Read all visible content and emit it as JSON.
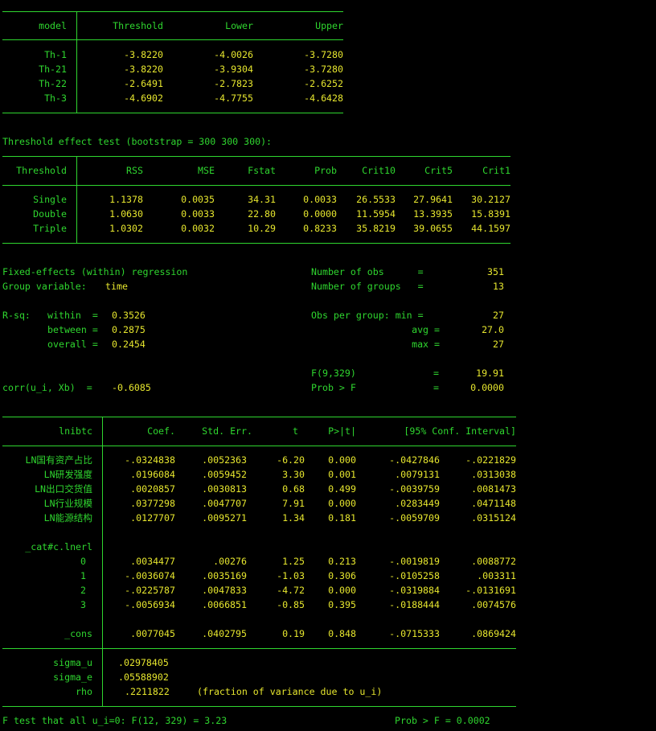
{
  "colors": {
    "background": "#000000",
    "text_green": "#2fd62f",
    "value_yellow": "#e6e62e"
  },
  "table1": {
    "headers": [
      "model",
      "Threshold",
      "Lower",
      "Upper"
    ],
    "rows": [
      [
        "Th-1",
        "-3.8220",
        "-4.0026",
        "-3.7280"
      ],
      [
        "Th-21",
        "-3.8220",
        "-3.9304",
        "-3.7280"
      ],
      [
        "Th-22",
        "-2.6491",
        "-2.7823",
        "-2.6252"
      ],
      [
        "Th-3",
        "-4.6902",
        "-4.7755",
        "-4.6428"
      ]
    ]
  },
  "test_title": "Threshold effect test (bootstrap = 300 300 300):",
  "table2": {
    "headers": [
      "Threshold",
      "RSS",
      "MSE",
      "Fstat",
      "Prob",
      "Crit10",
      "Crit5",
      "Crit1"
    ],
    "rows": [
      [
        "Single",
        "1.1378",
        "0.0035",
        "34.31",
        "0.0033",
        "26.5533",
        "27.9641",
        "30.2127"
      ],
      [
        "Double",
        "1.0630",
        "0.0033",
        "22.80",
        "0.0000",
        "11.5954",
        "13.3935",
        "15.8391"
      ],
      [
        "Triple",
        "1.0302",
        "0.0032",
        "10.29",
        "0.8233",
        "35.8219",
        "39.0655",
        "44.1597"
      ]
    ]
  },
  "regression": {
    "title": "Fixed-effects (within) regression",
    "group_label": "Group variable: ",
    "group_var": "time",
    "rsq_label": "R-sq:",
    "within_label": "within  = ",
    "within_value": "0.3526",
    "between_label": "between = ",
    "between_value": "0.2875",
    "overall_label": "overall = ",
    "overall_value": "0.2454",
    "corr_label": "corr(u_i, Xb)  = ",
    "corr_value": "-0.6085",
    "nobs_label": "Number of obs      =",
    "nobs_value": "351",
    "ngroups_label": "Number of groups   =",
    "ngroups_value": "13",
    "obs_min_label": "Obs per group: min =",
    "obs_min_value": "27",
    "obs_avg_label": "avg =",
    "obs_avg_value": "27.0",
    "obs_max_label": "max =",
    "obs_max_value": "27",
    "f_label": "F(9,329)",
    "f_eq": "=",
    "f_value": "19.91",
    "probf_label": "Prob > F",
    "probf_eq": "=",
    "probf_value": "0.0000"
  },
  "table3": {
    "headers": [
      "lnibtc",
      "Coef.",
      "Std. Err.",
      "t",
      "P>|t|",
      "[95% Conf. Interval]"
    ],
    "rows": [
      [
        "LN国有资产占比",
        "-.0324838",
        ".0052363",
        "-6.20",
        "0.000",
        "-.0427846",
        "-.0221829"
      ],
      [
        "LN研发强度",
        ".0196084",
        ".0059452",
        "3.30",
        "0.001",
        ".0079131",
        ".0313038"
      ],
      [
        "LN出口交货值",
        ".0020857",
        ".0030813",
        "0.68",
        "0.499",
        "-.0039759",
        ".0081473"
      ],
      [
        "LN行业规模",
        ".0377298",
        ".0047707",
        "7.91",
        "0.000",
        ".0283449",
        ".0471148"
      ],
      [
        "LN能源结构",
        ".0127707",
        ".0095271",
        "1.34",
        "0.181",
        "-.0059709",
        ".0315124"
      ]
    ],
    "cat_label": "_cat#c.lnerl",
    "cat_rows": [
      [
        "0",
        ".0034477",
        ".00276",
        "1.25",
        "0.213",
        "-.0019819",
        ".0088772"
      ],
      [
        "1",
        "-.0036074",
        ".0035169",
        "-1.03",
        "0.306",
        "-.0105258",
        ".003311"
      ],
      [
        "2",
        "-.0225787",
        ".0047833",
        "-4.72",
        "0.000",
        "-.0319884",
        "-.0131691"
      ],
      [
        "3",
        "-.0056934",
        ".0066851",
        "-0.85",
        "0.395",
        "-.0188444",
        ".0074576"
      ]
    ],
    "cons_row": [
      "_cons",
      ".0077045",
      ".0402795",
      "0.19",
      "0.848",
      "-.0715333",
      ".0869424"
    ],
    "sigma_u_label": "sigma_u",
    "sigma_u_value": ".02978405",
    "sigma_e_label": "sigma_e",
    "sigma_e_value": ".05588902",
    "rho_label": "rho",
    "rho_value": ".2211822",
    "rho_note": "(fraction of variance due to u_i)"
  },
  "ftest": {
    "label": "F test that all u_i=0: F(12, 329) = 3.23",
    "prob": "Prob > F = 0.0002"
  }
}
